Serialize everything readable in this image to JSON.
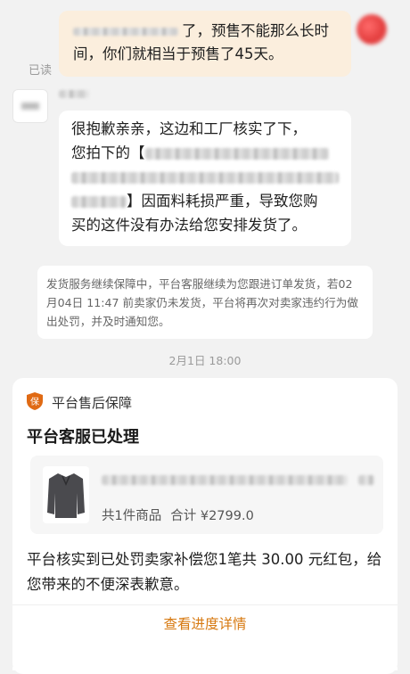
{
  "own_message": {
    "line1_text": "了，预售不能那么长时",
    "line2_text": "间，你们就相当于预售了45天。"
  },
  "read_label": "已读",
  "seller_message": {
    "line1": "很抱歉亲亲，这边和工厂核实了下，",
    "line2_prefix": "您拍下的【",
    "line4_suffix": "】因面料耗损严重，导致您购",
    "line5": "买的这件没有办法给您安排发货了。"
  },
  "system_notice": {
    "text": "发货服务继续保障中，平台客服继续为您跟进订单发货，若02月04日 11:47 前卖家仍未发货，平台将再次对卖家违约行为做出处罚，并及时通知您。"
  },
  "timestamp": "2月1日 18:00",
  "aftersale_card": {
    "header": "平台售后保障",
    "shield_char": "保",
    "shield_color": "#e06a14",
    "title": "平台客服已处理",
    "product": {
      "count_text": "共1件商品",
      "total_text": "合计 ¥2799.0"
    },
    "message": "平台核实到已处罚卖家补偿您1笔共 30.00 元红包，给您带来的不便深表歉意。",
    "progress_button": "查看进度详情",
    "accent_color": "#d77a12"
  }
}
